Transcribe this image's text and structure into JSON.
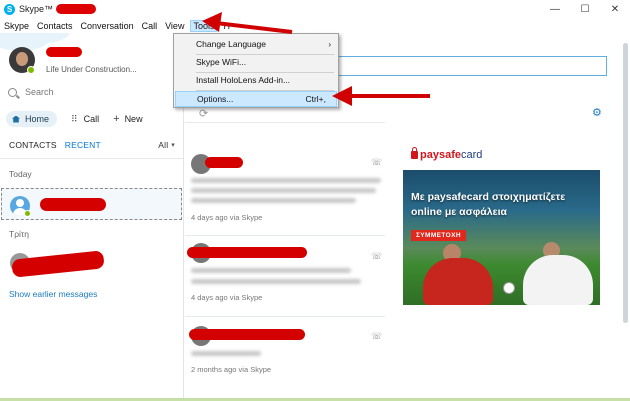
{
  "window": {
    "title": "Skype™",
    "controls": {
      "minimize": "—",
      "maximize": "☐",
      "close": "✕"
    }
  },
  "menubar": {
    "items": [
      {
        "label": "Skype"
      },
      {
        "label": "Contacts"
      },
      {
        "label": "Conversation"
      },
      {
        "label": "Call"
      },
      {
        "label": "View"
      },
      {
        "label": "Tools"
      },
      {
        "label": "H"
      }
    ]
  },
  "tools_menu": {
    "items": [
      {
        "label": "Change Language",
        "arrow": "›"
      },
      {
        "label": "Skype WiFi..."
      },
      {
        "label": "Install HoloLens Add-in..."
      },
      {
        "label": "Options...",
        "shortcut": "Ctrl+,"
      }
    ]
  },
  "profile": {
    "mood": "Life Under Construction...",
    "status_color": "#7fba00"
  },
  "search": {
    "placeholder": "Search"
  },
  "nav": {
    "home": "Home",
    "call": "Call",
    "new": "New"
  },
  "tabs": {
    "contacts": "CONTACTS",
    "recent": "RECENT",
    "filter": "All"
  },
  "sections": {
    "today": "Today",
    "day2": "Τρίτη",
    "show_earlier": "Show earlier messages"
  },
  "feed": [
    {
      "time": "4 days ago via Skype"
    },
    {
      "time": "4 days ago via Skype"
    },
    {
      "time": "2 months ago via Skype"
    }
  ],
  "ad": {
    "brand_main": "paysafe",
    "brand_suffix": "card",
    "headline": "Με paysafecard στοιχηματίζετε online με ασφάλεια",
    "cta": "ΣΥΜΜΕΤΟΧΗ",
    "brand_color": "#d4161c"
  },
  "colors": {
    "accent": "#0078d7",
    "skype_blue": "#00aff0",
    "link": "#1c7bbf",
    "annotation_red": "#d00000"
  }
}
